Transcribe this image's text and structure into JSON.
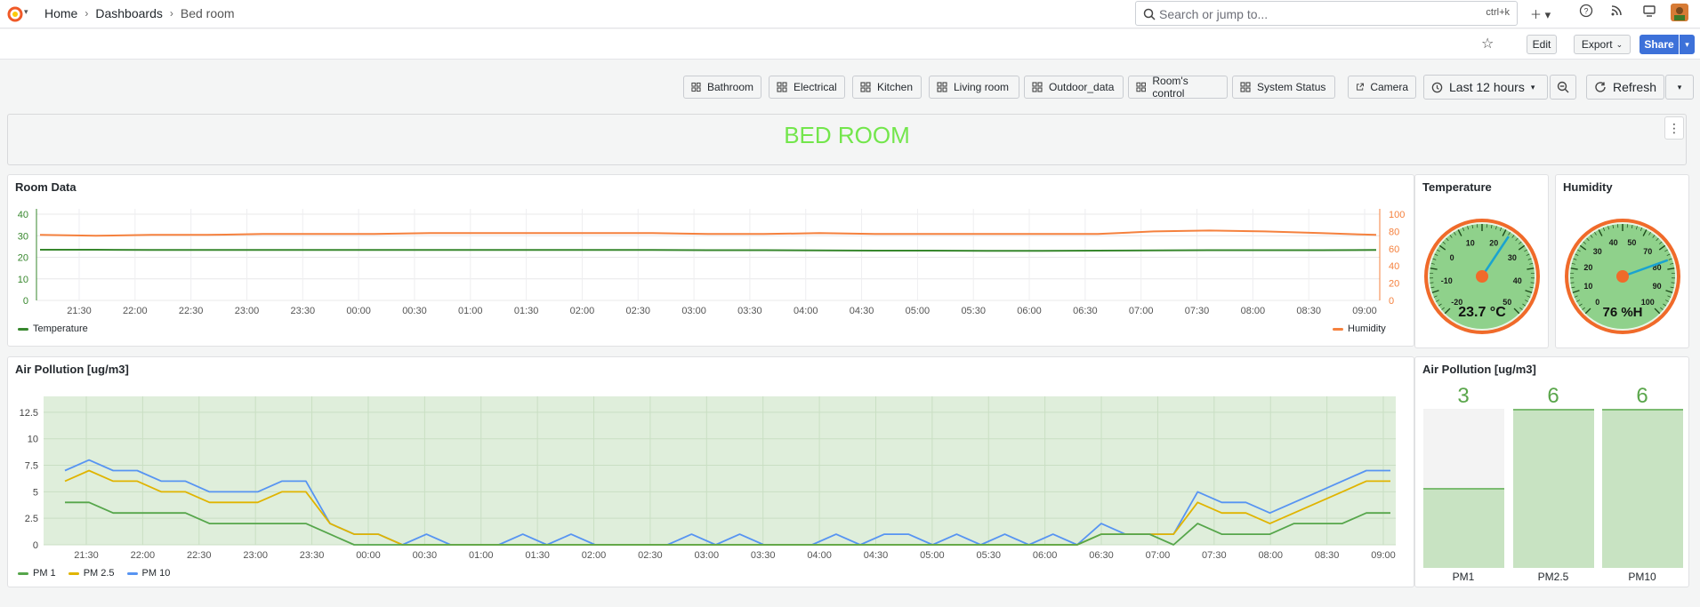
{
  "breadcrumb": {
    "home": "Home",
    "dashboards": "Dashboards",
    "current": "Bed room"
  },
  "search": {
    "placeholder": "Search or jump to...",
    "shortcut": "ctrl+k"
  },
  "toolbar": {
    "edit": "Edit",
    "export": "Export",
    "share": "Share"
  },
  "links": [
    "Bathroom",
    "Electrical",
    "Kitchen",
    "Living room",
    "Outdoor_data",
    "Room's control",
    "System Status",
    "Camera"
  ],
  "time": {
    "range": "Last 12 hours",
    "refresh": "Refresh"
  },
  "title_panel": {
    "text": "BED ROOM",
    "color": "#73e64c"
  },
  "room_data": {
    "title": "Room Data",
    "legend_left": "Temperature",
    "legend_right": "Humidity"
  },
  "gauges": {
    "temperature": {
      "title": "Temperature",
      "value": "23.7",
      "unit": "°C",
      "ticks": [
        "-20",
        "-10",
        "0",
        "10",
        "20",
        "30",
        "40",
        "50"
      ]
    },
    "humidity": {
      "title": "Humidity",
      "value": "76 %H",
      "ticks": [
        "0",
        "10",
        "20",
        "30",
        "40",
        "50",
        "70",
        "80",
        "90",
        "100"
      ]
    }
  },
  "air_pollution": {
    "title": "Air Pollution [ug/m3]",
    "legend": [
      "PM 1",
      "PM 2.5",
      "PM 10"
    ]
  },
  "air_bars": {
    "title": "Air Pollution [ug/m3]",
    "items": [
      {
        "name": "PM1",
        "value": "3"
      },
      {
        "name": "PM2.5",
        "value": "6"
      },
      {
        "name": "PM10",
        "value": "6"
      }
    ]
  },
  "colors": {
    "temperature": "#37872d",
    "humidity": "#f5813e",
    "pm1": "#56a64b",
    "pm25": "#e0b400",
    "pm10": "#5794f2",
    "gauge_green": "#8fd18b",
    "gauge_ring": "#f06a2a"
  },
  "chart_data": [
    {
      "type": "line",
      "title": "Room Data",
      "x_ticks": [
        "21:30",
        "22:00",
        "22:30",
        "23:00",
        "23:30",
        "00:00",
        "00:30",
        "01:00",
        "01:30",
        "02:00",
        "02:30",
        "03:00",
        "03:30",
        "04:00",
        "04:30",
        "05:00",
        "05:30",
        "06:00",
        "06:30",
        "07:00",
        "07:30",
        "08:00",
        "08:30",
        "09:00"
      ],
      "y_left": {
        "ticks": [
          0,
          10,
          20,
          30,
          40
        ],
        "ylim": [
          0,
          40
        ]
      },
      "y_right": {
        "ticks": [
          0,
          20,
          40,
          60,
          80,
          100
        ],
        "ylim": [
          0,
          100
        ]
      },
      "series": [
        {
          "name": "Temperature",
          "axis": "left",
          "values": [
            23.5,
            23.5,
            23.4,
            23.4,
            23.4,
            23.4,
            23.4,
            23.4,
            23.4,
            23.4,
            23.4,
            23.4,
            23.3,
            23.3,
            23.2,
            23.1,
            23.1,
            23.0,
            23.0,
            23.1,
            23.2,
            23.3,
            23.3,
            23.3,
            23.4
          ]
        },
        {
          "name": "Humidity",
          "axis": "right",
          "values": [
            76,
            75,
            76,
            76,
            77,
            77,
            77,
            78,
            78,
            78,
            78,
            78,
            77,
            77,
            78,
            77,
            77,
            77,
            77,
            77,
            80,
            81,
            80,
            78,
            76
          ]
        }
      ]
    },
    {
      "type": "line",
      "title": "Air Pollution [ug/m3]",
      "x_ticks": [
        "21:30",
        "22:00",
        "22:30",
        "23:00",
        "23:30",
        "00:00",
        "00:30",
        "01:00",
        "01:30",
        "02:00",
        "02:30",
        "03:00",
        "03:30",
        "04:00",
        "04:30",
        "05:00",
        "05:30",
        "06:00",
        "06:30",
        "07:00",
        "07:30",
        "08:00",
        "08:30",
        "09:00"
      ],
      "y_ticks": [
        "0",
        "2.5",
        "5",
        "7.5",
        "10",
        "12.5"
      ],
      "ylim": [
        0,
        14
      ],
      "series": [
        {
          "name": "PM 1",
          "values": [
            4,
            4,
            3,
            3,
            3,
            3,
            2,
            2,
            2,
            2,
            2,
            1,
            0,
            0,
            0,
            0,
            0,
            0,
            0,
            0,
            0,
            0,
            0,
            0,
            0,
            0,
            0,
            0,
            0,
            0,
            0,
            0,
            0,
            0,
            0,
            0,
            0,
            0,
            0,
            0,
            0,
            0,
            0,
            1,
            1,
            1,
            0,
            2,
            1,
            1,
            1,
            2,
            2,
            2,
            3,
            3
          ]
        },
        {
          "name": "PM 2.5",
          "values": [
            6,
            7,
            6,
            6,
            5,
            5,
            4,
            4,
            4,
            5,
            5,
            2,
            1,
            1,
            0,
            0,
            0,
            0,
            0,
            0,
            0,
            0,
            0,
            0,
            0,
            0,
            0,
            0,
            0,
            0,
            0,
            0,
            0,
            0,
            0,
            0,
            0,
            0,
            0,
            0,
            0,
            0,
            0,
            1,
            1,
            1,
            1,
            4,
            3,
            3,
            2,
            3,
            4,
            5,
            6,
            6
          ]
        },
        {
          "name": "PM 10",
          "values": [
            7,
            8,
            7,
            7,
            6,
            6,
            5,
            5,
            5,
            6,
            6,
            2,
            1,
            1,
            0,
            1,
            0,
            0,
            0,
            1,
            0,
            1,
            0,
            0,
            0,
            0,
            1,
            0,
            1,
            0,
            0,
            0,
            1,
            0,
            1,
            1,
            0,
            1,
            0,
            1,
            0,
            1,
            0,
            2,
            1,
            1,
            1,
            5,
            4,
            4,
            3,
            4,
            5,
            6,
            7,
            7
          ]
        }
      ]
    },
    {
      "type": "bar",
      "title": "Air Pollution [ug/m3]",
      "categories": [
        "PM1",
        "PM2.5",
        "PM10"
      ],
      "values": [
        3,
        6,
        6
      ]
    }
  ]
}
